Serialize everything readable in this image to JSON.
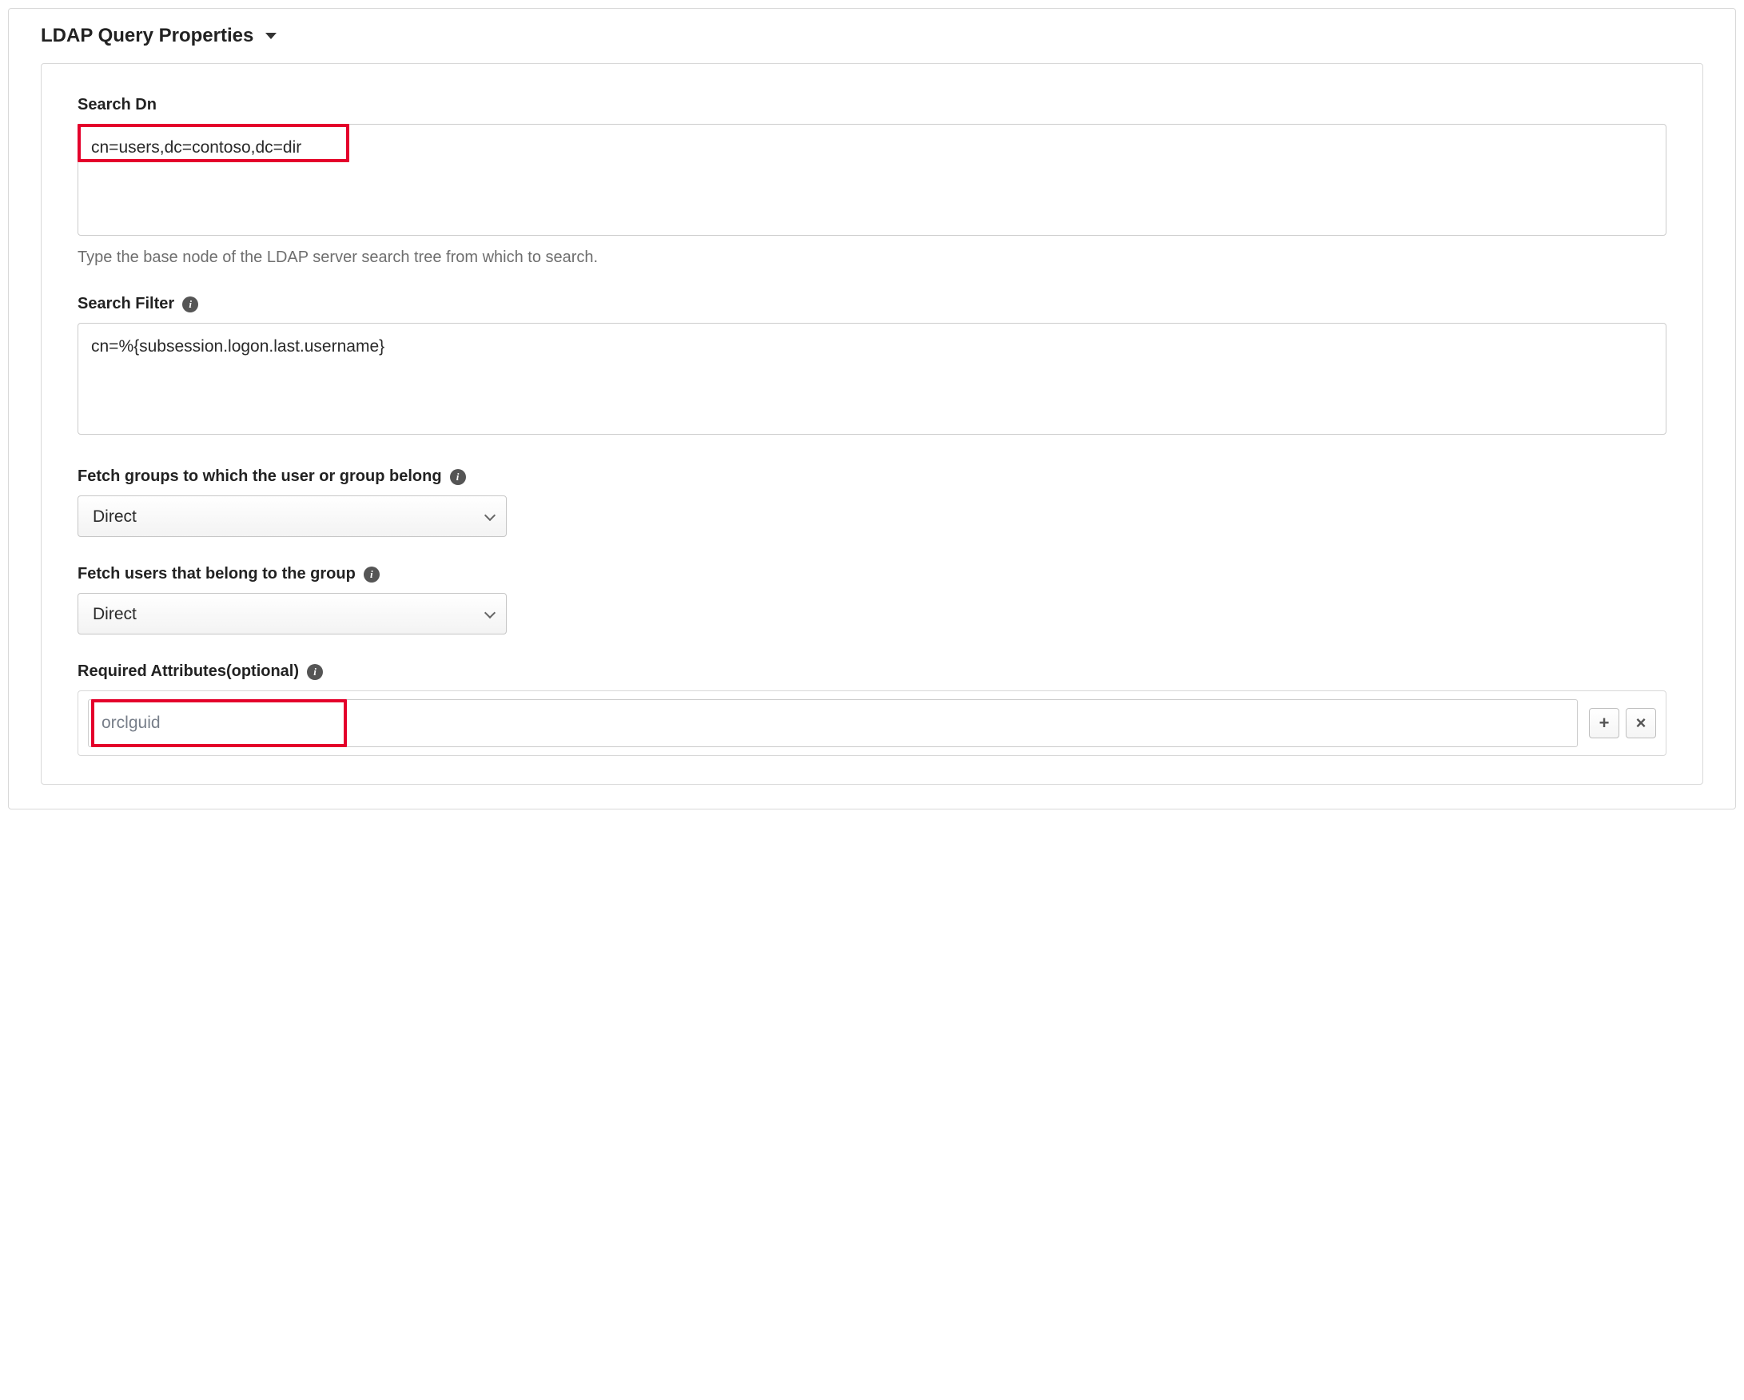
{
  "section": {
    "title": "LDAP Query Properties"
  },
  "fields": {
    "searchDn": {
      "label": "Search Dn",
      "value": "cn=users,dc=contoso,dc=dir",
      "helper": "Type the base node of the LDAP server search tree from which to search."
    },
    "searchFilter": {
      "label": "Search Filter",
      "value": "cn=%{subsession.logon.last.username}"
    },
    "fetchGroups": {
      "label": "Fetch groups to which the user or group belong",
      "value": "Direct"
    },
    "fetchUsers": {
      "label": "Fetch users that belong to the group",
      "value": "Direct"
    },
    "requiredAttrs": {
      "label": "Required Attributes(optional)",
      "placeholder": "orclguid"
    }
  },
  "icons": {
    "info": "i",
    "plus": "+",
    "times": "×"
  }
}
